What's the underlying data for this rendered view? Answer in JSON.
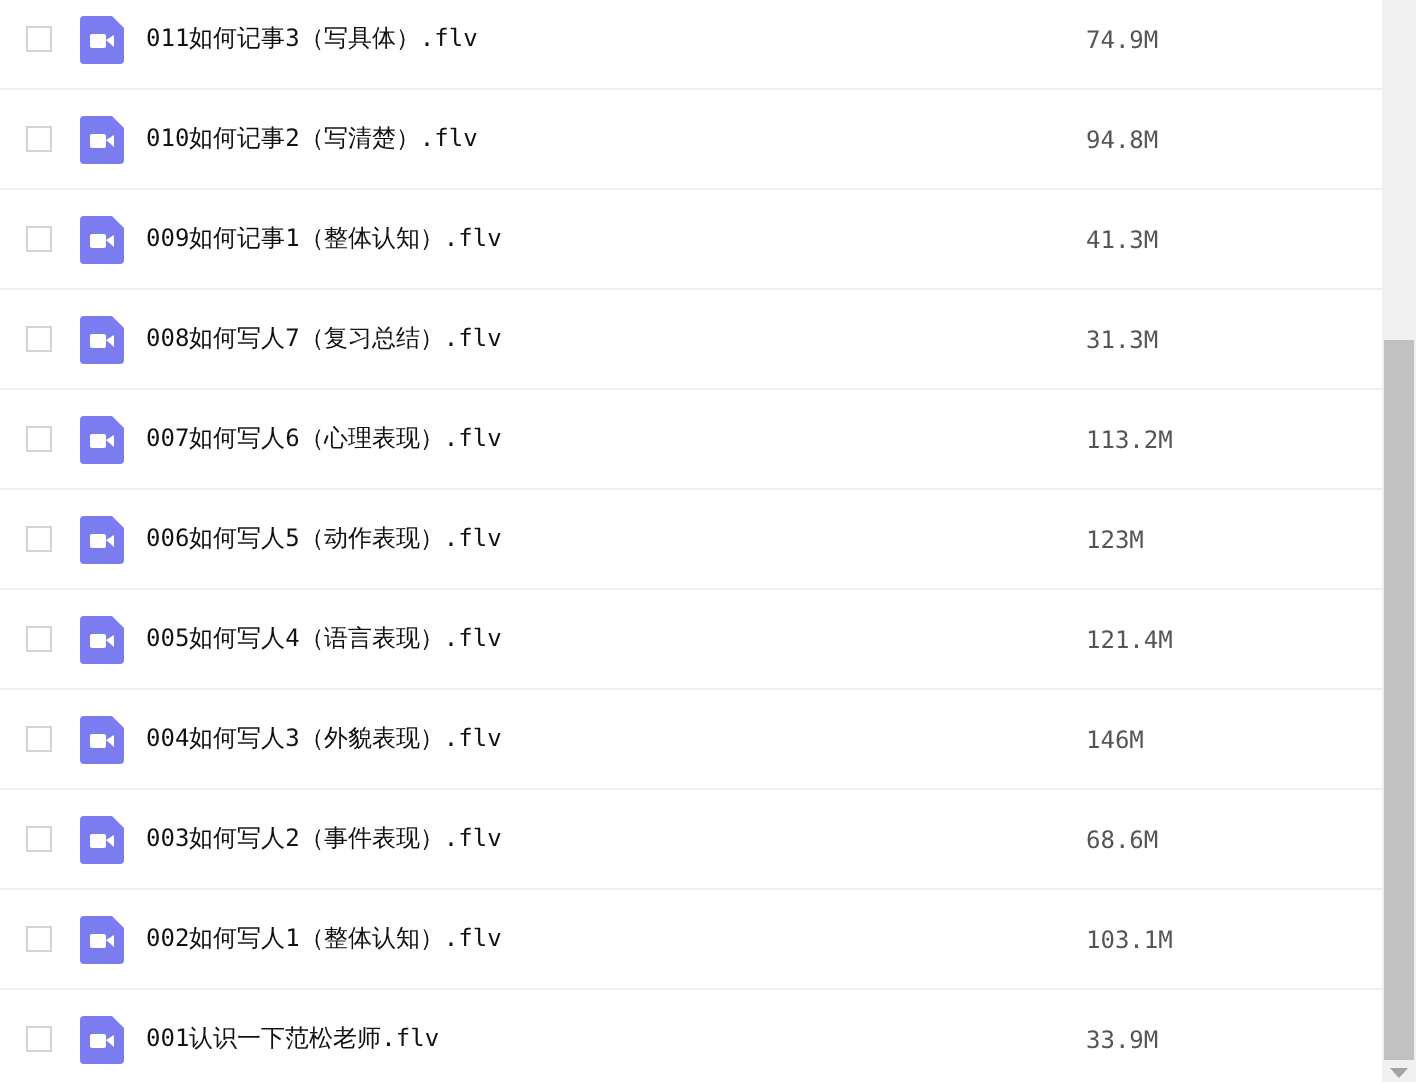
{
  "files": [
    {
      "name": "011如何记事3（写具体）.flv",
      "size": "74.9M",
      "checked": false
    },
    {
      "name": "010如何记事2（写清楚）.flv",
      "size": "94.8M",
      "checked": false
    },
    {
      "name": "009如何记事1（整体认知）.flv",
      "size": "41.3M",
      "checked": false
    },
    {
      "name": "008如何写人7（复习总结）.flv",
      "size": "31.3M",
      "checked": false
    },
    {
      "name": "007如何写人6（心理表现）.flv",
      "size": "113.2M",
      "checked": false
    },
    {
      "name": "006如何写人5（动作表现）.flv",
      "size": "123M",
      "checked": false
    },
    {
      "name": "005如何写人4（语言表现）.flv",
      "size": "121.4M",
      "checked": false
    },
    {
      "name": "004如何写人3（外貌表现）.flv",
      "size": "146M",
      "checked": false
    },
    {
      "name": "003如何写人2（事件表现）.flv",
      "size": "68.6M",
      "checked": false
    },
    {
      "name": "002如何写人1（整体认知）.flv",
      "size": "103.1M",
      "checked": false
    },
    {
      "name": "001认识一下范松老师.flv",
      "size": "33.9M",
      "checked": false
    }
  ]
}
